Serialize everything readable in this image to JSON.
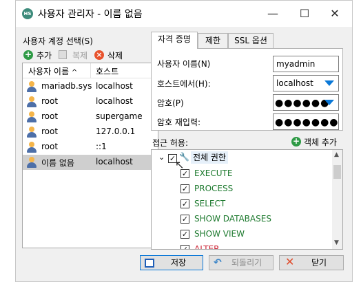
{
  "window": {
    "title": "사용자 관리자 - 이름 없음",
    "app_icon_text": "HS"
  },
  "left": {
    "section_title": "사용자 계정 선택(S)",
    "toolbar": {
      "add": "추가",
      "copy": "복제",
      "delete": "삭제"
    },
    "columns": {
      "user": "사용자 이름",
      "host": "호스트"
    },
    "users": [
      {
        "name": "mariadb.sys",
        "host": "localhost"
      },
      {
        "name": "root",
        "host": "localhost"
      },
      {
        "name": "root",
        "host": "supergame"
      },
      {
        "name": "root",
        "host": "127.0.0.1"
      },
      {
        "name": "root",
        "host": "::1"
      },
      {
        "name": "이름 없음",
        "host": "localhost"
      }
    ]
  },
  "tabs": [
    "자격 증명",
    "제한",
    "SSL 옵션"
  ],
  "credentials": {
    "username_label": "사용자 이름(N)",
    "username_value": "myadmin",
    "host_label": "호스트에서(H):",
    "host_value": "localhost",
    "password_label": "암호(P)",
    "password_value": "●●●●●●",
    "repeat_label": "암호 재입력:",
    "repeat_value": "●●●●●●●"
  },
  "access": {
    "label": "접근 허용:",
    "add_object": "객체 추가",
    "root_label": "전체 권한",
    "privileges": [
      "EXECUTE",
      "PROCESS",
      "SELECT",
      "SHOW DATABASES",
      "SHOW VIEW",
      "ALTER"
    ]
  },
  "buttons": {
    "save": "저장",
    "revert": "되돌리기",
    "close": "닫기"
  },
  "titlebar_glyphs": {
    "minimize": "—",
    "maximize": "☐",
    "close": "✕"
  }
}
